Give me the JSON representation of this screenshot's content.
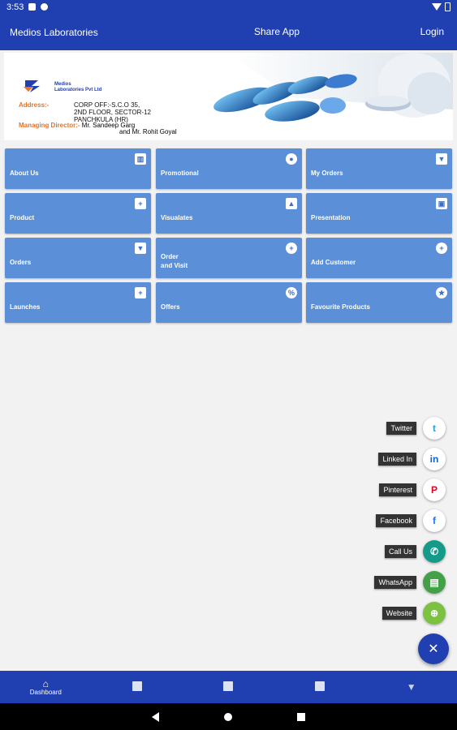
{
  "status_bar": {
    "time": "3:53"
  },
  "app_bar": {
    "title": "Medios Laboratories",
    "share_label": "Share App",
    "login_label": "Login"
  },
  "banner": {
    "company_line1": "Medios",
    "company_line2": "Laboratories Pvt Ltd",
    "address_label": "Address:-",
    "address_line1": "CORP OFF:-S.C.O 35,",
    "address_line2": "2ND FLOOR, SECTOR-12",
    "address_line3": "PANCHKULA (HR)",
    "md_label": "Managing Director:-",
    "md_line1": "Mr. Sandeep Garg",
    "md_line2": "and Mr. Rohit Goyal"
  },
  "tiles": [
    {
      "label": "About Us",
      "icon": "building-icon"
    },
    {
      "label": "Promotional",
      "icon": "group-icon"
    },
    {
      "label": "My Orders",
      "icon": "cart-icon"
    },
    {
      "label": "Product",
      "icon": "plus-box-icon"
    },
    {
      "label": "Visualates",
      "icon": "image-icon"
    },
    {
      "label": "Presentation",
      "icon": "gallery-icon"
    },
    {
      "label": "Orders",
      "icon": "cart-icon"
    },
    {
      "label": "Order",
      "label2": "and Visit",
      "icon": "plus-circle-icon"
    },
    {
      "label": "Add Customer",
      "icon": "add-person-icon"
    },
    {
      "label": "Launches",
      "icon": "plus-box-icon"
    },
    {
      "label": "Offers",
      "icon": "percent-icon"
    },
    {
      "label": "Favourite Products",
      "icon": "star-icon"
    }
  ],
  "speed_dial": [
    {
      "label": "Twitter",
      "icon": "twitter-icon",
      "bg": "#ffffff",
      "fg": "#1da1f2"
    },
    {
      "label": "Linked In",
      "icon": "linkedin-icon",
      "bg": "#ffffff",
      "fg": "#0a66c2"
    },
    {
      "label": "Pinterest",
      "icon": "pinterest-icon",
      "bg": "#ffffff",
      "fg": "#e60023"
    },
    {
      "label": "Facebook",
      "icon": "facebook-icon",
      "bg": "#ffffff",
      "fg": "#1877f2"
    },
    {
      "label": "Call Us",
      "icon": "phone-icon",
      "bg": "#159a8a",
      "fg": "#ffffff"
    },
    {
      "label": "WhatsApp",
      "icon": "chat-icon",
      "bg": "#43a047",
      "fg": "#ffffff"
    },
    {
      "label": "Website",
      "icon": "globe-icon",
      "bg": "#7cc142",
      "fg": "#ffffff"
    }
  ],
  "fab_icon": "close-icon",
  "bottom_nav": [
    {
      "label": "Dashboard",
      "icon": "home-icon"
    },
    {
      "label": "",
      "icon": "gallery-icon"
    },
    {
      "label": "",
      "icon": "plus-box-icon"
    },
    {
      "label": "",
      "icon": "image-icon"
    },
    {
      "label": "",
      "icon": "cart-icon"
    }
  ],
  "colors": {
    "primary": "#203fb0",
    "tile": "#5b8fd8",
    "background": "#f2f2f2",
    "accent_orange": "#e5742a"
  }
}
